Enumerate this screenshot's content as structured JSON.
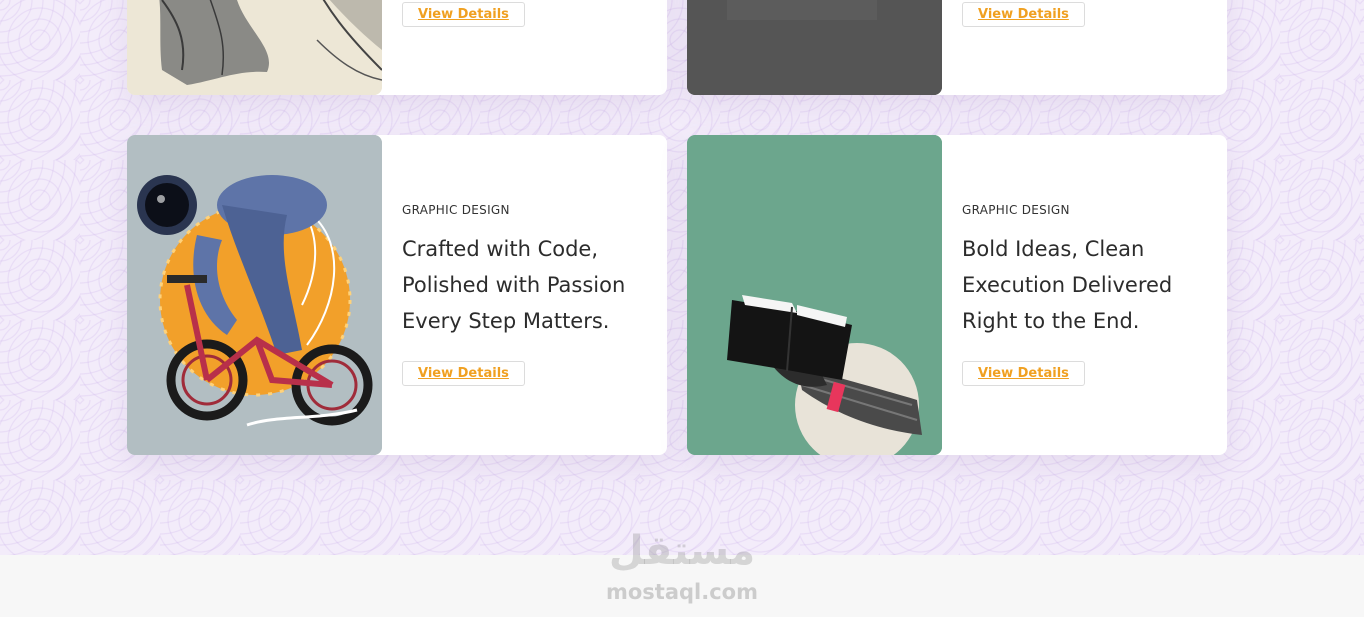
{
  "cards": [
    {
      "category": "",
      "title": "",
      "button_label": "View Details",
      "image": "hand-sketch-image"
    },
    {
      "category": "",
      "title": "",
      "button_label": "View Details",
      "image": "dark-gray-image"
    },
    {
      "category": "GRAPHIC DESIGN",
      "title": "Crafted with Code, Polished with Passion Every Step Matters.",
      "title_lines": [
        "Crafted with Code,",
        "Polished with Passion",
        "Every Step Matters."
      ],
      "button_label": "View Details",
      "image": "astronaut-bicycle-illustration"
    },
    {
      "category": "GRAPHIC DESIGN",
      "title": "Bold Ideas, Clean Execution Delivered Right to the End.",
      "title_lines": [
        "Bold Ideas, Clean",
        "Execution Delivered",
        "Right to the End."
      ],
      "button_label": "View Details",
      "image": "hand-holding-book-collage"
    }
  ],
  "footer": {
    "logo_arabic": "مستقل",
    "logo_latin": "mostaql.com"
  },
  "colors": {
    "accent": "#f0a020",
    "background": "#f3ecfa",
    "card": "#ffffff"
  }
}
